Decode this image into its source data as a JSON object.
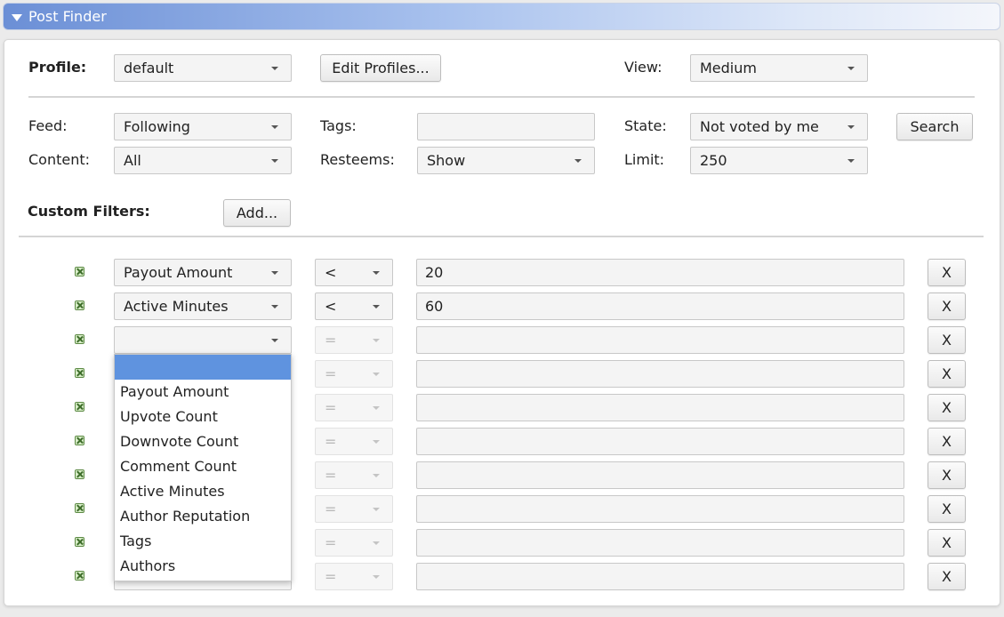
{
  "window": {
    "title": "Post Finder"
  },
  "profile": {
    "label": "Profile:",
    "value": "default",
    "edit_button": "Edit Profiles..."
  },
  "view": {
    "label": "View:",
    "value": "Medium"
  },
  "feed": {
    "label": "Feed:",
    "value": "Following"
  },
  "tags": {
    "label": "Tags:",
    "value": ""
  },
  "state": {
    "label": "State:",
    "value": "Not voted by me"
  },
  "search_button": "Search",
  "content": {
    "label": "Content:",
    "value": "All"
  },
  "resteems": {
    "label": "Resteems:",
    "value": "Show"
  },
  "limit": {
    "label": "Limit:",
    "value": "250"
  },
  "custom_filters": {
    "label": "Custom Filters:",
    "add_button": "Add..."
  },
  "filters": [
    {
      "field": "Payout Amount",
      "op": "<",
      "value": "20",
      "remove": "X"
    },
    {
      "field": "Active Minutes",
      "op": "<",
      "value": "60",
      "remove": "X"
    },
    {
      "field": "",
      "op": "=",
      "value": "",
      "remove": "X"
    },
    {
      "field": "",
      "op": "=",
      "value": "",
      "remove": "X"
    },
    {
      "field": "",
      "op": "=",
      "value": "",
      "remove": "X"
    },
    {
      "field": "",
      "op": "=",
      "value": "",
      "remove": "X"
    },
    {
      "field": "",
      "op": "=",
      "value": "",
      "remove": "X"
    },
    {
      "field": "",
      "op": "=",
      "value": "",
      "remove": "X"
    },
    {
      "field": "",
      "op": "=",
      "value": "",
      "remove": "X"
    },
    {
      "field": "",
      "op": "=",
      "value": "",
      "remove": "X"
    }
  ],
  "dropdown_options": [
    "",
    "Payout Amount",
    "Upvote Count",
    "Downvote Count",
    "Comment Count",
    "Active Minutes",
    "Author Reputation",
    "Tags",
    "Authors"
  ],
  "colors": {
    "accent": "#5f93df",
    "title_gradient_start": "#6b8fd6"
  }
}
